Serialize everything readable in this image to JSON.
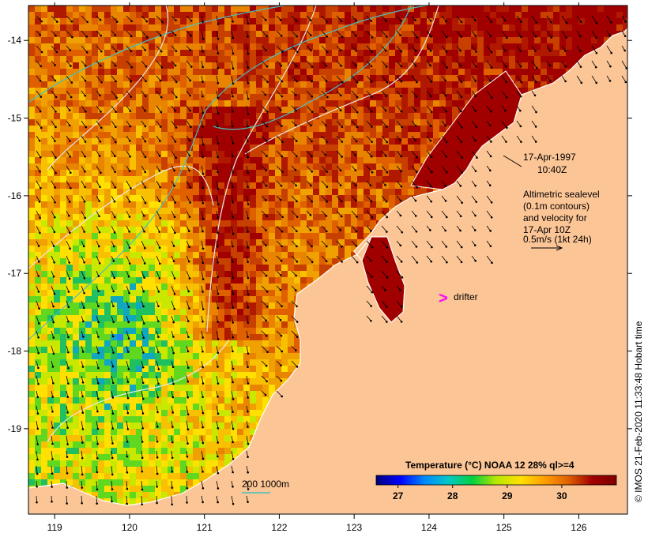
{
  "map": {
    "lon_range": [
      118.65,
      126.65
    ],
    "lat_range": [
      -20.1,
      -13.55
    ],
    "lon_ticks": [
      119,
      120,
      121,
      122,
      123,
      124,
      125,
      126
    ],
    "lat_ticks": [
      -14,
      -15,
      -16,
      -17,
      -18,
      -19
    ],
    "colors": {
      "land": "#fcc596",
      "sea_warm": "#a00000",
      "sea_mid": "#e89000",
      "coast": "#ffffff",
      "contour": "#e8e8e8",
      "isobath": "#48c0c0",
      "drifter": "#ff00ff",
      "arrow": "#000000"
    }
  },
  "annotations": {
    "date": "17-Apr-1997",
    "time": "10:40Z",
    "legend_lines": [
      "Altimetric sealevel",
      "(0.1m contours)",
      "and velocity for",
      "17-Apr 10Z",
      "0.5m/s (1kt 24h)"
    ],
    "drifter_marker": ">",
    "drifter_label": "drifter",
    "isobath_label": "200  1000m",
    "credit": "© IMOS 21-Feb-2020 11:33:48 Hobart time"
  },
  "colorbar": {
    "title": "Temperature (°C) NOAA 12 28% ql>=4",
    "range": [
      26.6,
      31.0
    ],
    "ticks": [
      27,
      28,
      29,
      30
    ],
    "stops": [
      "#00007a",
      "#0000ff",
      "#0088ff",
      "#00c8c8",
      "#00d040",
      "#b8e800",
      "#ffe000",
      "#ffa000",
      "#e06000",
      "#a00000",
      "#800000"
    ]
  }
}
